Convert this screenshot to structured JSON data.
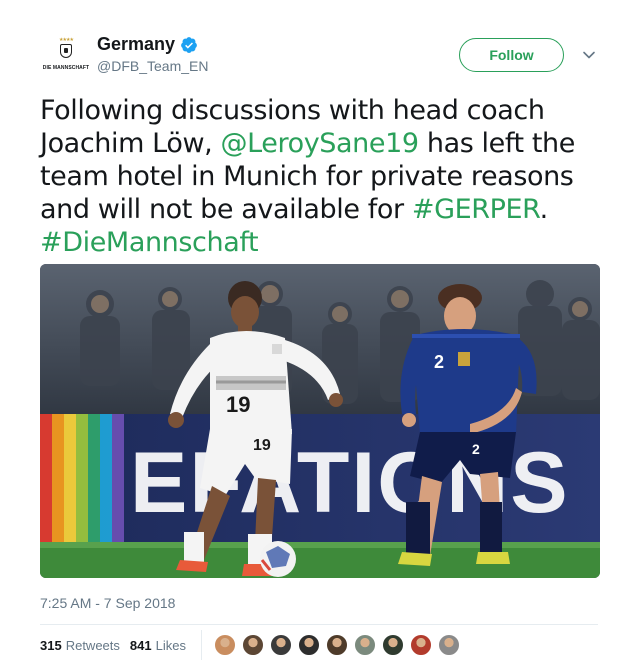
{
  "header": {
    "avatar_text": "DIE MANNSCHAFT",
    "display_name": "Germany",
    "handle": "@DFB_Team_EN",
    "follow_label": "Follow"
  },
  "tweet": {
    "text_part1": "Following discussions with head coach Joachim Löw, ",
    "mention": "@LeroySane19",
    "text_part2": " has left the team hotel in Munich for private reasons and will not be available for ",
    "hashtag1": "#GERPER",
    "text_part3": ". ",
    "hashtag2": "#DieMannschaft"
  },
  "media": {
    "banner_text": "EFATIONS LE",
    "player1_number": "19",
    "player2_number": "2"
  },
  "meta": {
    "timestamp": "7:25 AM - 7 Sep 2018"
  },
  "stats": {
    "retweets_count": "315",
    "retweets_label": "Retweets",
    "likes_count": "841",
    "likes_label": "Likes"
  },
  "colors": {
    "link": "#2aa05a",
    "verified": "#1da1f2",
    "secondary_text": "#657786"
  },
  "likers": [
    {
      "icon": "liker-avatar-1",
      "color": "#c98d5f"
    },
    {
      "icon": "liker-avatar-2",
      "color": "#5c4634"
    },
    {
      "icon": "liker-avatar-3",
      "color": "#3a3a3a"
    },
    {
      "icon": "liker-avatar-4",
      "color": "#2d2d2d"
    },
    {
      "icon": "liker-avatar-5",
      "color": "#4e3b2a"
    },
    {
      "icon": "liker-avatar-6",
      "color": "#7b8a7d"
    },
    {
      "icon": "liker-avatar-7",
      "color": "#2f3b2f"
    },
    {
      "icon": "liker-avatar-8",
      "color": "#b23b2c"
    },
    {
      "icon": "liker-avatar-9",
      "color": "#8a8a8a"
    }
  ]
}
